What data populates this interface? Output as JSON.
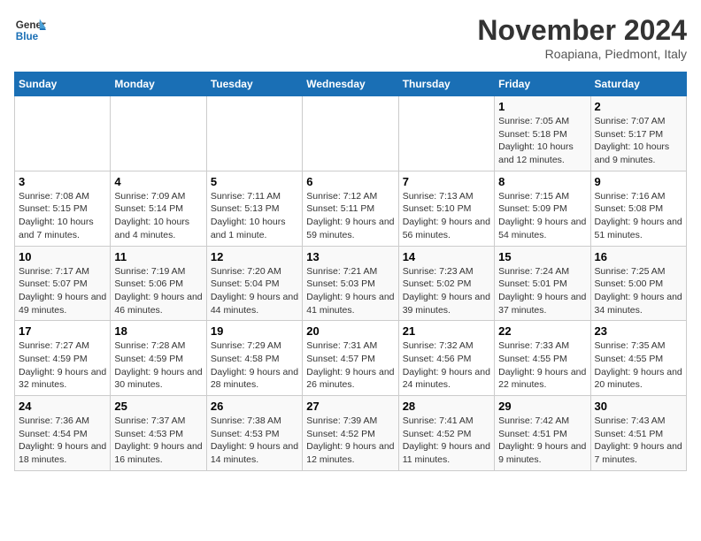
{
  "header": {
    "logo_general": "General",
    "logo_blue": "Blue",
    "month_title": "November 2024",
    "location": "Roapiana, Piedmont, Italy"
  },
  "weekdays": [
    "Sunday",
    "Monday",
    "Tuesday",
    "Wednesday",
    "Thursday",
    "Friday",
    "Saturday"
  ],
  "weeks": [
    [
      {
        "day": "",
        "info": ""
      },
      {
        "day": "",
        "info": ""
      },
      {
        "day": "",
        "info": ""
      },
      {
        "day": "",
        "info": ""
      },
      {
        "day": "",
        "info": ""
      },
      {
        "day": "1",
        "info": "Sunrise: 7:05 AM\nSunset: 5:18 PM\nDaylight: 10 hours and 12 minutes."
      },
      {
        "day": "2",
        "info": "Sunrise: 7:07 AM\nSunset: 5:17 PM\nDaylight: 10 hours and 9 minutes."
      }
    ],
    [
      {
        "day": "3",
        "info": "Sunrise: 7:08 AM\nSunset: 5:15 PM\nDaylight: 10 hours and 7 minutes."
      },
      {
        "day": "4",
        "info": "Sunrise: 7:09 AM\nSunset: 5:14 PM\nDaylight: 10 hours and 4 minutes."
      },
      {
        "day": "5",
        "info": "Sunrise: 7:11 AM\nSunset: 5:13 PM\nDaylight: 10 hours and 1 minute."
      },
      {
        "day": "6",
        "info": "Sunrise: 7:12 AM\nSunset: 5:11 PM\nDaylight: 9 hours and 59 minutes."
      },
      {
        "day": "7",
        "info": "Sunrise: 7:13 AM\nSunset: 5:10 PM\nDaylight: 9 hours and 56 minutes."
      },
      {
        "day": "8",
        "info": "Sunrise: 7:15 AM\nSunset: 5:09 PM\nDaylight: 9 hours and 54 minutes."
      },
      {
        "day": "9",
        "info": "Sunrise: 7:16 AM\nSunset: 5:08 PM\nDaylight: 9 hours and 51 minutes."
      }
    ],
    [
      {
        "day": "10",
        "info": "Sunrise: 7:17 AM\nSunset: 5:07 PM\nDaylight: 9 hours and 49 minutes."
      },
      {
        "day": "11",
        "info": "Sunrise: 7:19 AM\nSunset: 5:06 PM\nDaylight: 9 hours and 46 minutes."
      },
      {
        "day": "12",
        "info": "Sunrise: 7:20 AM\nSunset: 5:04 PM\nDaylight: 9 hours and 44 minutes."
      },
      {
        "day": "13",
        "info": "Sunrise: 7:21 AM\nSunset: 5:03 PM\nDaylight: 9 hours and 41 minutes."
      },
      {
        "day": "14",
        "info": "Sunrise: 7:23 AM\nSunset: 5:02 PM\nDaylight: 9 hours and 39 minutes."
      },
      {
        "day": "15",
        "info": "Sunrise: 7:24 AM\nSunset: 5:01 PM\nDaylight: 9 hours and 37 minutes."
      },
      {
        "day": "16",
        "info": "Sunrise: 7:25 AM\nSunset: 5:00 PM\nDaylight: 9 hours and 34 minutes."
      }
    ],
    [
      {
        "day": "17",
        "info": "Sunrise: 7:27 AM\nSunset: 4:59 PM\nDaylight: 9 hours and 32 minutes."
      },
      {
        "day": "18",
        "info": "Sunrise: 7:28 AM\nSunset: 4:59 PM\nDaylight: 9 hours and 30 minutes."
      },
      {
        "day": "19",
        "info": "Sunrise: 7:29 AM\nSunset: 4:58 PM\nDaylight: 9 hours and 28 minutes."
      },
      {
        "day": "20",
        "info": "Sunrise: 7:31 AM\nSunset: 4:57 PM\nDaylight: 9 hours and 26 minutes."
      },
      {
        "day": "21",
        "info": "Sunrise: 7:32 AM\nSunset: 4:56 PM\nDaylight: 9 hours and 24 minutes."
      },
      {
        "day": "22",
        "info": "Sunrise: 7:33 AM\nSunset: 4:55 PM\nDaylight: 9 hours and 22 minutes."
      },
      {
        "day": "23",
        "info": "Sunrise: 7:35 AM\nSunset: 4:55 PM\nDaylight: 9 hours and 20 minutes."
      }
    ],
    [
      {
        "day": "24",
        "info": "Sunrise: 7:36 AM\nSunset: 4:54 PM\nDaylight: 9 hours and 18 minutes."
      },
      {
        "day": "25",
        "info": "Sunrise: 7:37 AM\nSunset: 4:53 PM\nDaylight: 9 hours and 16 minutes."
      },
      {
        "day": "26",
        "info": "Sunrise: 7:38 AM\nSunset: 4:53 PM\nDaylight: 9 hours and 14 minutes."
      },
      {
        "day": "27",
        "info": "Sunrise: 7:39 AM\nSunset: 4:52 PM\nDaylight: 9 hours and 12 minutes."
      },
      {
        "day": "28",
        "info": "Sunrise: 7:41 AM\nSunset: 4:52 PM\nDaylight: 9 hours and 11 minutes."
      },
      {
        "day": "29",
        "info": "Sunrise: 7:42 AM\nSunset: 4:51 PM\nDaylight: 9 hours and 9 minutes."
      },
      {
        "day": "30",
        "info": "Sunrise: 7:43 AM\nSunset: 4:51 PM\nDaylight: 9 hours and 7 minutes."
      }
    ]
  ]
}
